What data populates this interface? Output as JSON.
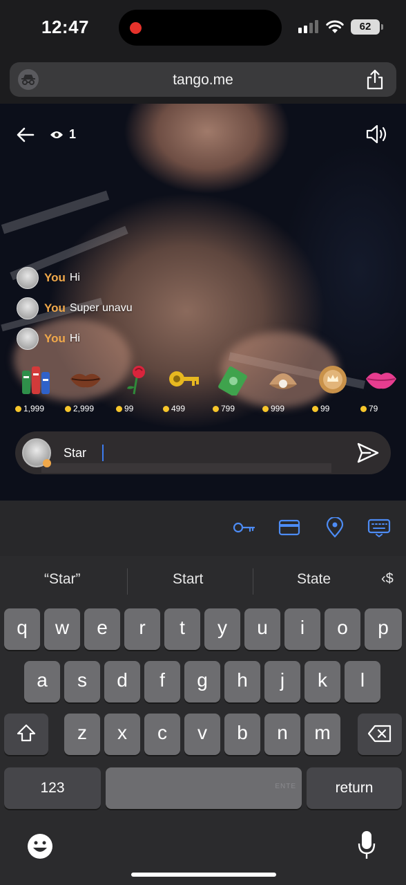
{
  "status_bar": {
    "time": "12:47",
    "battery": "62"
  },
  "browser": {
    "url": "tango.me",
    "incognito_icon": "incognito-icon",
    "share_icon": "share-icon"
  },
  "stream": {
    "viewer_count": "1",
    "back_icon": "arrow-left-icon",
    "speaker_icon": "speaker-icon",
    "chat": [
      {
        "name": "You",
        "text": "Hi"
      },
      {
        "name": "You",
        "text": "Super unavu"
      },
      {
        "name": "You",
        "text": "Hi"
      }
    ],
    "gifts": [
      {
        "icon": "casino-chips-icon",
        "price": "1,999"
      },
      {
        "icon": "lips-icon",
        "price": "2,999"
      },
      {
        "icon": "rose-icon",
        "price": "99"
      },
      {
        "icon": "key-icon",
        "price": "499"
      },
      {
        "icon": "money-icon",
        "price": "799"
      },
      {
        "icon": "pearl-shell-icon",
        "price": "999"
      },
      {
        "icon": "crown-coin-icon",
        "price": "99"
      },
      {
        "icon": "kiss-lips-icon",
        "price": "79"
      }
    ],
    "input_value": "Star"
  },
  "accessory_bar": {
    "icons": [
      "key-icon",
      "credit-card-icon",
      "location-pin-icon",
      "keyboard-icon"
    ]
  },
  "keyboard": {
    "suggestions": [
      "“Star”",
      "Start",
      "State"
    ],
    "row1": [
      "q",
      "w",
      "e",
      "r",
      "t",
      "y",
      "u",
      "i",
      "o",
      "p"
    ],
    "row2": [
      "a",
      "s",
      "d",
      "f",
      "g",
      "h",
      "j",
      "k",
      "l"
    ],
    "row3": [
      "z",
      "x",
      "c",
      "v",
      "b",
      "n",
      "m"
    ],
    "numbers_key": "123",
    "return_key": "return",
    "space_hint": "ENTE"
  },
  "colors": {
    "accent_blue": "#3d7cf0",
    "chat_name": "#f0a84a",
    "coin": "#f7c62b",
    "record": "#e5322b"
  }
}
